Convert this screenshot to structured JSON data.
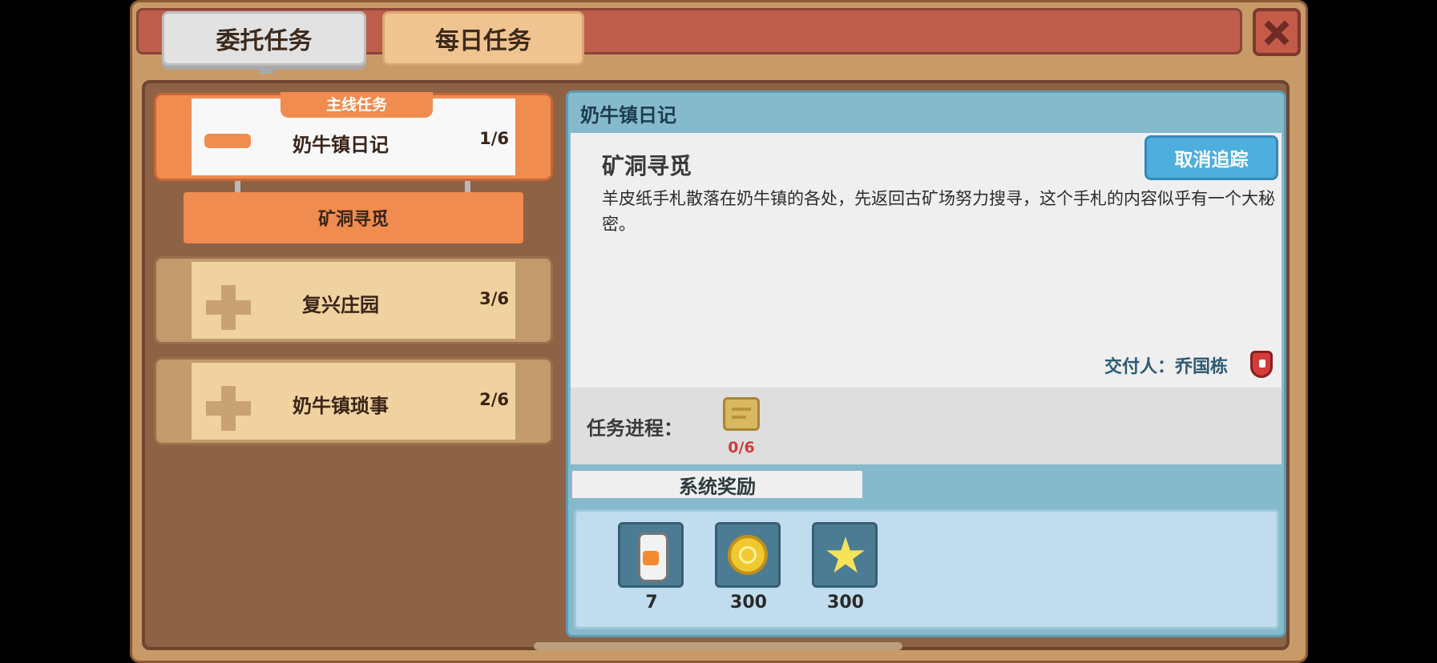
{
  "tabs": {
    "entrust": "委托任务",
    "daily": "每日任务"
  },
  "quest_list": {
    "active": {
      "tag": "主线任务",
      "title": "奶牛镇日记",
      "count": "1/6",
      "sub_quest": "矿洞寻觅"
    },
    "items": [
      {
        "title": "复兴庄园",
        "count": "3/6"
      },
      {
        "title": "奶牛镇琐事",
        "count": "2/6"
      }
    ]
  },
  "detail": {
    "header": "奶牛镇日记",
    "name": "矿洞寻觅",
    "untrack_label": "取消追踪",
    "description": "羊皮纸手札散落在奶牛镇的各处，先返回古矿场努力搜寻，这个手札的内容似乎有一个大秘密。",
    "giver": "交付人：乔国栋",
    "progress_label": "任务进程：",
    "progress_count": "0/6"
  },
  "rewards": {
    "tab_label": "系统奖励",
    "items": [
      {
        "icon": "milk-bottle-icon",
        "value": "7"
      },
      {
        "icon": "gold-coin-icon",
        "value": "300"
      },
      {
        "icon": "star-icon",
        "value": "300"
      }
    ]
  },
  "colors": {
    "accent_orange": "#f08c4f",
    "title_red": "#bf5d4d",
    "panel_blue": "#85bacc",
    "button_blue": "#4eaede",
    "progress_red": "#d43a3a"
  }
}
